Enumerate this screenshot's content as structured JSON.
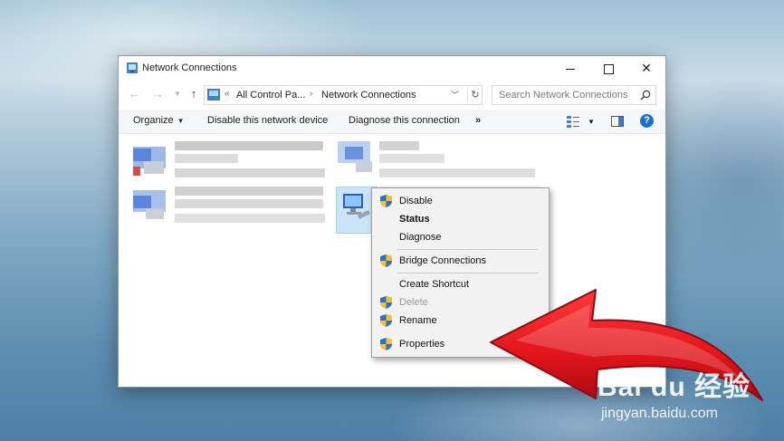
{
  "window": {
    "title": "Network Connections",
    "controls": {
      "minimize": "—",
      "close": "✕"
    }
  },
  "nav": {
    "address": {
      "chevron": "«",
      "segments": [
        "All Control Pa...",
        "Network Connections"
      ],
      "separator": "›",
      "refresh": "↻"
    },
    "search": {
      "placeholder": "Search Network Connections"
    }
  },
  "commandbar": {
    "organize": "Organize",
    "disable": "Disable this network device",
    "diagnose": "Diagnose this connection",
    "more": "»",
    "help": "?"
  },
  "context_menu": {
    "items": [
      {
        "label": "Disable",
        "icon": "shield-icon",
        "style": "normal"
      },
      {
        "label": "Status",
        "icon": "",
        "style": "bold"
      },
      {
        "label": "Diagnose",
        "icon": "",
        "style": "normal"
      },
      {
        "label": "Bridge Connections",
        "icon": "shield-icon",
        "style": "normal"
      },
      {
        "label": "Create Shortcut",
        "icon": "",
        "style": "normal"
      },
      {
        "label": "Delete",
        "icon": "shield-icon",
        "style": "disabled"
      },
      {
        "label": "Rename",
        "icon": "shield-icon",
        "style": "normal"
      },
      {
        "label": "Properties",
        "icon": "shield-icon",
        "style": "normal"
      }
    ]
  },
  "watermark": {
    "logo": "Bai du 经验",
    "url": "jingyan.baidu.com"
  },
  "colors": {
    "accent_blue": "#1a6fd0",
    "arrow_red": "#e0141c",
    "shield_blue": "#2f6fc4",
    "shield_yellow": "#f2c230"
  }
}
